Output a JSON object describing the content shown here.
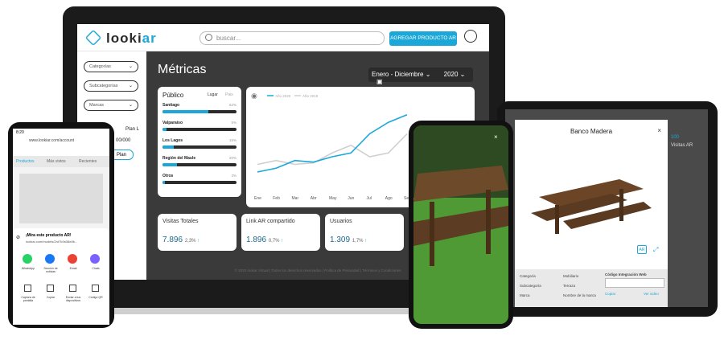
{
  "brand": {
    "name_prefix": "looki",
    "name_suffix": "ar"
  },
  "header": {
    "search_placeholder": "buscar...",
    "add_button": "AGREGAR PRODUCTO AR"
  },
  "sidebar": {
    "filters": [
      "Categorías",
      "Subcategorías",
      "Marcas"
    ],
    "plan_label": "Plan L",
    "plan_count": "00/000",
    "plan_button": "Plan"
  },
  "main": {
    "title": "Métricas",
    "range": "Enero - Diciembre",
    "year": "2020"
  },
  "publico": {
    "title": "Público",
    "tabs": [
      "Lugar",
      "Pais"
    ],
    "rows": [
      {
        "name": "Santiago",
        "pct": "62%",
        "value": 0.62
      },
      {
        "name": "Valparaíso",
        "pct": "5%",
        "value": 0.05
      },
      {
        "name": "Los Lagos",
        "pct": "15%",
        "value": 0.15
      },
      {
        "name": "Región del Maule",
        "pct": "20%",
        "value": 0.2
      },
      {
        "name": "Otros",
        "pct": "3%",
        "value": 0.03
      }
    ]
  },
  "chart_data": {
    "type": "line",
    "categories": [
      "Ene",
      "Feb",
      "Mar",
      "Abr",
      "May",
      "Jun",
      "Jul",
      "Ago",
      "Sep"
    ],
    "series": [
      {
        "name": "Año 2020",
        "values": [
          0.2,
          0.25,
          0.35,
          0.33,
          0.4,
          0.45,
          0.7,
          0.85,
          0.95
        ],
        "color": "#1ba8d9"
      },
      {
        "name": "Año 2019",
        "values": [
          0.3,
          0.35,
          0.3,
          0.32,
          0.45,
          0.55,
          0.4,
          0.45,
          0.7
        ],
        "color": "#cfcfcf"
      }
    ]
  },
  "stats": [
    {
      "title": "Visitas Totales",
      "value": "7.896",
      "pct": "2,3%"
    },
    {
      "title": "Link AR compartido",
      "value": "1.896",
      "pct": "0,7%"
    },
    {
      "title": "Usuarios",
      "value": "1.309",
      "pct": "1,7%"
    }
  ],
  "footer": "© 2020 lookar Virtual | Todos los derechos reservados | Política de Privacidad | Términos y Condiciones",
  "tablet": {
    "modal_title": "Banco Madera",
    "close": "×",
    "ar": "AR",
    "info": [
      [
        "Categoría",
        "Mobiliario"
      ],
      [
        "Subcategoría",
        "Terraza"
      ],
      [
        "Marca",
        "Nombre de la marca"
      ]
    ],
    "code_title": "Código Integración Web",
    "copy": "Copiar",
    "view": "Ver video",
    "side_count": "100",
    "side_label": "Visitas AR"
  },
  "phoneL": {
    "time": "8:20",
    "url": "www.lookiar.com/account",
    "tabs": [
      "Productos",
      "Más vistos",
      "Recientes"
    ],
    "share_title": "¡Mira este producto AR!",
    "share_url": "lookiar.com/models/2rd7k9a38e8b...",
    "apps": [
      "WhatsApp",
      "Sección de noticias",
      "Email",
      "Chats"
    ],
    "actions": [
      "Captura de pantalla",
      "Copiar",
      "Enviar a tus dispositivos",
      "Código QR"
    ],
    "side": "ce"
  }
}
